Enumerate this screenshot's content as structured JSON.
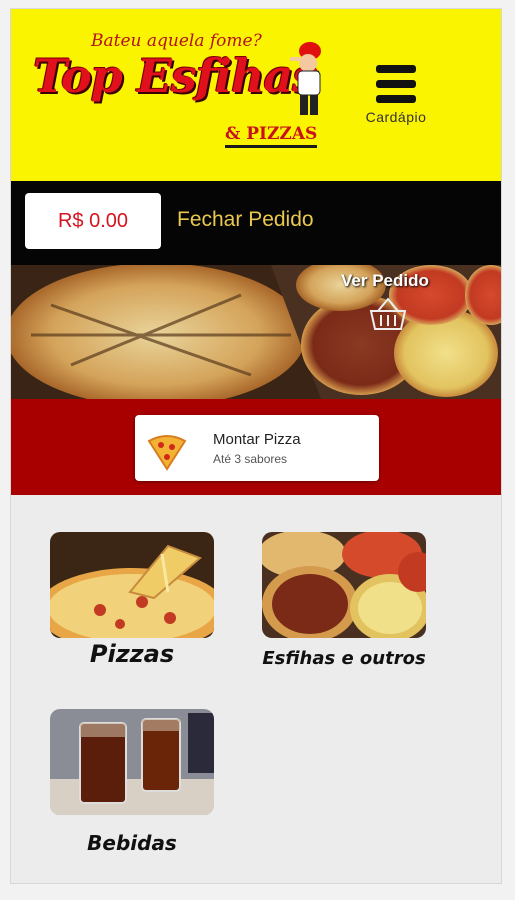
{
  "header": {
    "tagline": "Bateu aquela fome?",
    "logo_main": "Top Esfihas",
    "logo_sub": "& PIZZAS",
    "menu_label": "Cardápio"
  },
  "order": {
    "total": "R$ 0.00",
    "close_label": "Fechar Pedido"
  },
  "banner": {
    "view_order_label": "Ver Pedido"
  },
  "build_pizza": {
    "title": "Montar Pizza",
    "subtitle": "Até 3 sabores"
  },
  "categories": [
    {
      "label": "Pizzas",
      "icon": "pizza-photo"
    },
    {
      "label": "Esfihas e outros",
      "icon": "esfiha-photo"
    },
    {
      "label": "Bebidas",
      "icon": "drinks-photo"
    }
  ],
  "colors": {
    "header_bg": "#fbf400",
    "order_bar_bg": "#050505",
    "total_text": "#d41420",
    "close_text": "#e9c84e",
    "accent_red": "#a80000"
  }
}
